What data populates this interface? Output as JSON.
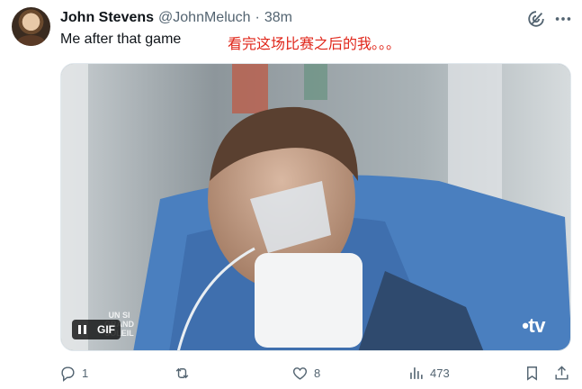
{
  "tweet": {
    "author_name": "John Stevens",
    "author_handle": "@JohnMeluch",
    "separator": "·",
    "time": "38m",
    "text": "Me after that game",
    "caption": "看完这场比赛之后的我。。。"
  },
  "media": {
    "type": "gif",
    "gif_label": "GIF",
    "watermark": "•tv",
    "show_logo_line1": "UN SI",
    "show_logo_line2": "GRAND",
    "show_logo_line3": "SOLEIL"
  },
  "actions": {
    "reply_count": "1",
    "repost_count": "",
    "like_count": "8",
    "view_count": "473"
  },
  "icons": {
    "grok": "grok-icon",
    "more": "more-icon",
    "reply": "reply-icon",
    "repost": "repost-icon",
    "like": "heart-icon",
    "views": "views-icon",
    "bookmark": "bookmark-icon",
    "share": "share-icon"
  },
  "colors": {
    "text_primary": "#0f1419",
    "text_secondary": "#536471",
    "caption_red": "#e0261a"
  }
}
